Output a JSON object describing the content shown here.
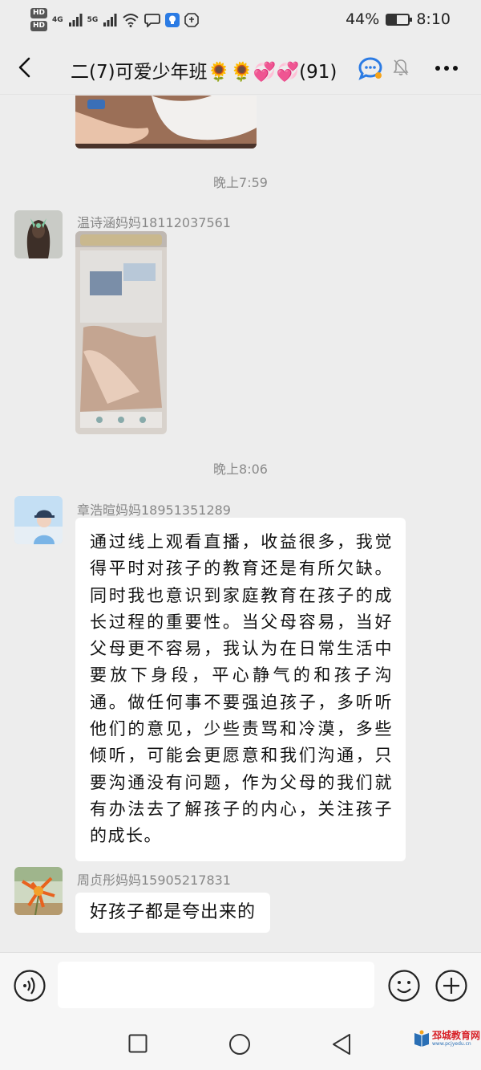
{
  "status_bar": {
    "hd1": "HD",
    "hd2": "HD",
    "net1": "4G",
    "net2": "5G",
    "battery_percent": "44%",
    "battery_level": 0.44,
    "time": "8:10"
  },
  "title_bar": {
    "title": "二(7)可爱少年班🌻🌻💞💞(91)"
  },
  "messages": {
    "time1": "晚上7:59",
    "sender1": "温诗涵妈妈18112037561",
    "time2": "晚上8:06",
    "sender2": "章浩暄妈妈18951351289",
    "text2": "通过线上观看直播，收益很多，我觉得平时对孩子的教育还是有所欠缺。同时我也意识到家庭教育在孩子的成长过程的重要性。当父母容易，当好父母更不容易，我认为在日常生活中要放下身段，平心静气的和孩子沟通。做任何事不要强迫孩子，多听听他们的意见，少些责骂和冷漠，多些倾听，可能会更愿意和我们沟通，只要沟通没有问题，作为父母的我们就有办法去了解孩子的内心，关注孩子的成长。",
    "sender3": "周贞彤妈妈15905217831",
    "text3": "好孩子都是夸出来的"
  },
  "watermark": {
    "title": "邳城教育网",
    "url": "www.pcjyedu.cn"
  },
  "colors": {
    "background": "#ededed",
    "bubble": "#ffffff",
    "watermark_red": "#d8232a"
  }
}
